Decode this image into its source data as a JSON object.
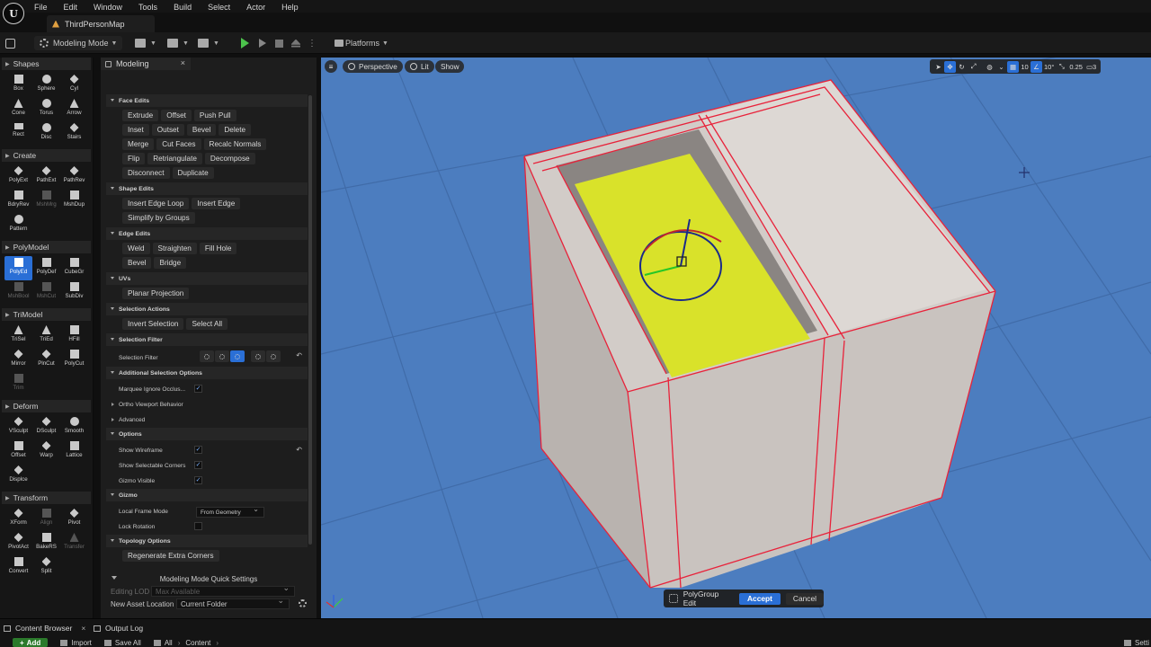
{
  "menubar": {
    "items": [
      "File",
      "Edit",
      "Window",
      "Tools",
      "Build",
      "Select",
      "Actor",
      "Help"
    ]
  },
  "level_tab": {
    "label": "ThirdPersonMap"
  },
  "toolbar": {
    "mode_label": "Modeling Mode",
    "platforms_label": "Platforms"
  },
  "palette": {
    "sections": [
      {
        "title": "Shapes",
        "tools": [
          "Box",
          "Sphere",
          "Cyl",
          "Cone",
          "Torus",
          "Arrow",
          "Rect",
          "Disc",
          "Stairs"
        ]
      },
      {
        "title": "Create",
        "tools": [
          "PolyExt",
          "PathExt",
          "PathRev",
          "BdryRev",
          "MshMrg",
          "MshDup",
          "Pattern"
        ]
      },
      {
        "title": "PolyModel",
        "tools": [
          "PolyEd",
          "PolyDef",
          "CubeGr",
          "MshBool",
          "MshCut",
          "SubDiv"
        ]
      },
      {
        "title": "TriModel",
        "tools": [
          "TriSel",
          "TriEd",
          "HFill",
          "Mirror",
          "PlnCut",
          "PolyCut",
          "Trim"
        ]
      },
      {
        "title": "Deform",
        "tools": [
          "VSculpt",
          "DSculpt",
          "Smooth",
          "Offset",
          "Warp",
          "Lattice",
          "Displce"
        ]
      },
      {
        "title": "Transform",
        "tools": [
          "XForm",
          "Align",
          "Pivot",
          "PivotAct",
          "BakeRS",
          "Transfer",
          "Convert",
          "Split"
        ]
      }
    ]
  },
  "panel": {
    "tab_label": "Modeling",
    "close": "×",
    "face_edits": {
      "title": "Face Edits",
      "rows": [
        [
          "Extrude",
          "Offset",
          "Push Pull"
        ],
        [
          "Inset",
          "Outset",
          "Bevel",
          "Delete"
        ],
        [
          "Merge",
          "Cut Faces",
          "Recalc Normals"
        ],
        [
          "Flip",
          "Retriangulate",
          "Decompose"
        ],
        [
          "Disconnect",
          "Duplicate"
        ]
      ]
    },
    "shape_edits": {
      "title": "Shape Edits",
      "rows": [
        [
          "Insert Edge Loop",
          "Insert Edge"
        ],
        [
          "Simplify by Groups"
        ]
      ]
    },
    "edge_edits": {
      "title": "Edge Edits",
      "rows": [
        [
          "Weld",
          "Straighten",
          "Fill Hole"
        ],
        [
          "Bevel",
          "Bridge"
        ]
      ]
    },
    "uvs": {
      "title": "UVs",
      "rows": [
        [
          "Planar Projection"
        ]
      ]
    },
    "selection_actions": {
      "title": "Selection Actions",
      "rows": [
        [
          "Invert Selection",
          "Select All"
        ]
      ]
    },
    "selection_filter": {
      "title": "Selection Filter",
      "label": "Selection Filter"
    },
    "additional_selection": {
      "title": "Additional Selection Options",
      "marquee": "Marquee Ignore Occlus...",
      "ortho": "Ortho Viewport Behavior",
      "advanced": "Advanced"
    },
    "options": {
      "title": "Options",
      "show_wireframe": "Show Wireframe",
      "show_corners": "Show Selectable Corners",
      "gizmo_visible": "Gizmo Visible"
    },
    "gizmo": {
      "title": "Gizmo",
      "local_frame_mode": "Local Frame Mode",
      "local_frame_value": "From Geometry",
      "lock_rotation": "Lock Rotation"
    },
    "topology": {
      "title": "Topology Options",
      "regen_button": "Regenerate Extra Corners"
    }
  },
  "quick_settings": {
    "title": "Modeling Mode Quick Settings",
    "editing_lod_label": "Editing LOD",
    "editing_lod_value": "Max Available",
    "asset_location_label": "New Asset Location",
    "asset_location_value": "Current Folder"
  },
  "viewport": {
    "perspective": "Perspective",
    "lit": "Lit",
    "show": "Show",
    "grid_snap": "10",
    "rot_snap": "10°",
    "scale_snap": "0.25",
    "cam_speed": "3",
    "colors": {
      "floor": "#4c7dbf",
      "cap": "#d9e22a",
      "edge": "#e8223a",
      "wall": "#c9c3bf"
    }
  },
  "edit_bar": {
    "label": "PolyGroup Edit",
    "accept": "Accept",
    "cancel": "Cancel"
  },
  "bottom": {
    "content_browser": "Content Browser",
    "output_log": "Output Log",
    "close": "×",
    "add": "Add",
    "import": "Import",
    "save_all": "Save All",
    "path_all": "All",
    "path_content": "Content",
    "settings": "Setti"
  }
}
